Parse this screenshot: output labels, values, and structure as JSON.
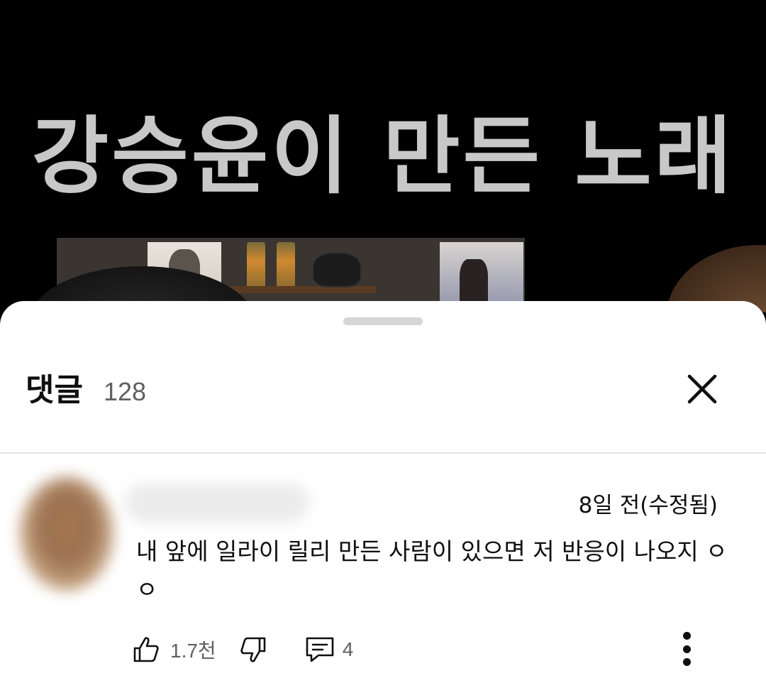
{
  "video": {
    "caption": "강승윤이 만든 노래"
  },
  "comments_panel": {
    "title": "댓글",
    "count": "128"
  },
  "comment": {
    "timestamp": "8일 전(수정됨)",
    "text": "내 앞에 일라이 릴리 만든 사람이 있으면 저 반응이 나오지 ㅇㅇ",
    "likes": "1.7천",
    "replies": "4"
  },
  "icons": {
    "close": "close-icon",
    "like": "thumbs-up-icon",
    "dislike": "thumbs-down-icon",
    "reply": "comment-icon",
    "more": "more-vertical-icon"
  }
}
